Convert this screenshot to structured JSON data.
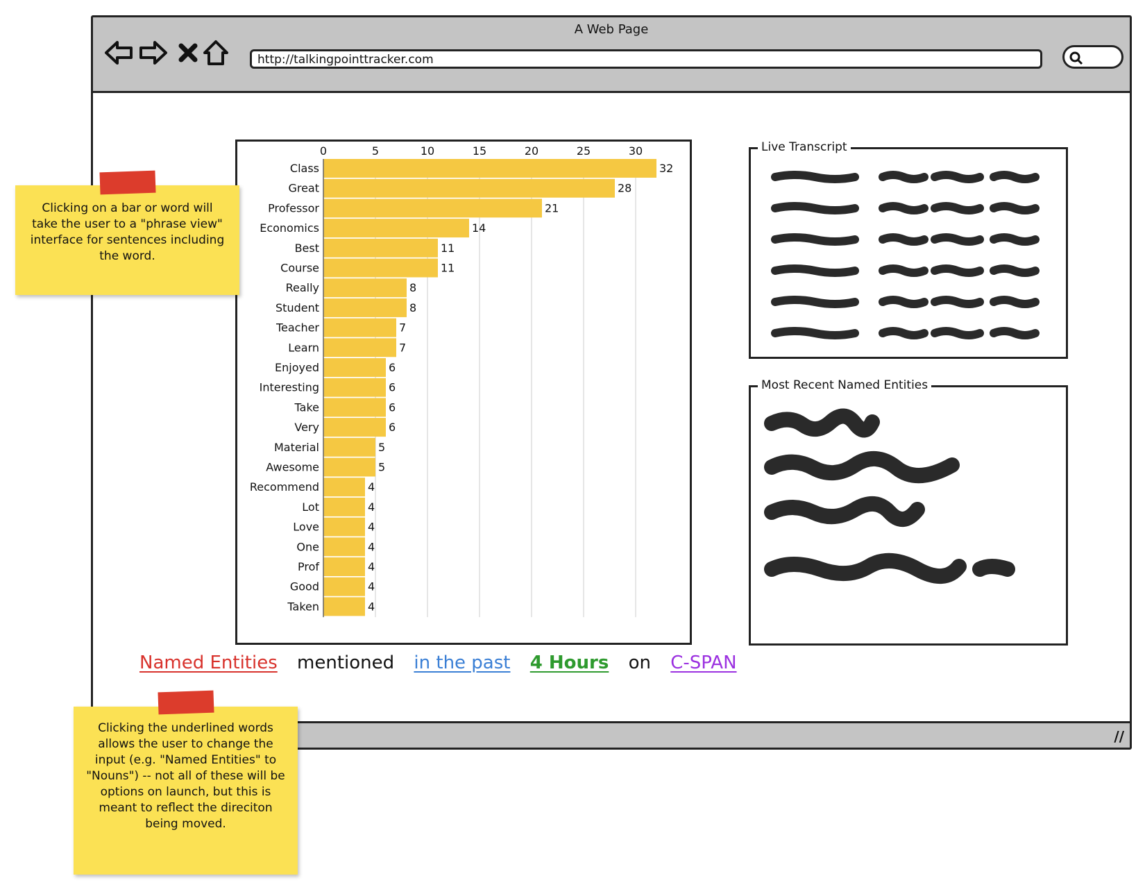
{
  "window": {
    "title": "A Web Page",
    "url": "http://talkingpointtracker.com"
  },
  "nav_icons": [
    "back-arrow-icon",
    "forward-arrow-icon",
    "close-x-icon",
    "home-icon",
    "search-icon"
  ],
  "chart_data": {
    "type": "bar",
    "orientation": "horizontal",
    "categories": [
      "Class",
      "Great",
      "Professor",
      "Economics",
      "Best",
      "Course",
      "Really",
      "Student",
      "Teacher",
      "Learn",
      "Enjoyed",
      "Interesting",
      "Take",
      "Very",
      "Material",
      "Awesome",
      "Recommend",
      "Lot",
      "Love",
      "One",
      "Prof",
      "Good",
      "Taken"
    ],
    "values": [
      32,
      28,
      21,
      14,
      11,
      11,
      8,
      8,
      7,
      7,
      6,
      6,
      6,
      6,
      5,
      5,
      4,
      4,
      4,
      4,
      4,
      4,
      4
    ],
    "xticks": [
      0,
      5,
      10,
      15,
      20,
      25,
      30
    ],
    "xlim": [
      0,
      33
    ],
    "bar_color": "#f5c842",
    "grid": true
  },
  "panels": {
    "transcript_label": "Live Transcript",
    "entities_label": "Most Recent Named Entities"
  },
  "sentence": {
    "part1": "Named Entities",
    "part2": "mentioned",
    "part3": "in the past",
    "part4": "4 Hours",
    "part5": "on",
    "part6": "C-SPAN"
  },
  "colors": {
    "part1": "#d8322c",
    "part3": "#3a7fd5",
    "part4": "#2e9a2e",
    "part6": "#9b30e0"
  },
  "notes": {
    "note1": "Clicking on a bar or word will take the user to a \"phrase view\" interface for sentences including the word.",
    "note2": "Clicking the underlined words allows the user to change the input (e.g. \"Named Entities\" to \"Nouns\") -- not all of these will be options on launch, but this is meant to reflect the direciton being moved."
  }
}
